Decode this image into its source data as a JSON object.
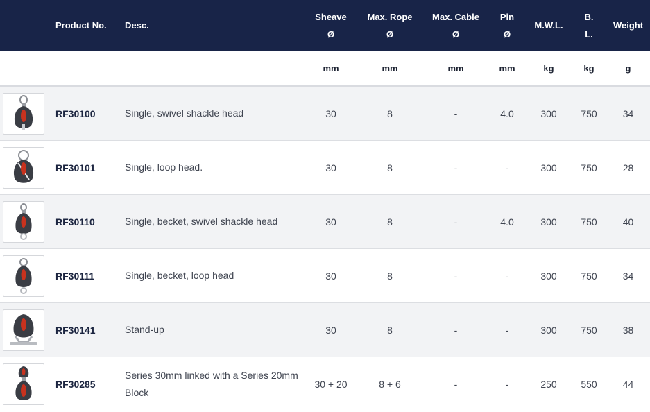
{
  "header": {
    "product_no": "Product No.",
    "desc": "Desc.",
    "sheave": [
      "Sheave",
      "Ø"
    ],
    "max_rope": [
      "Max. Rope",
      "Ø"
    ],
    "max_cable": [
      "Max. Cable",
      "Ø"
    ],
    "pin": [
      "Pin",
      "Ø"
    ],
    "mwl": "M.W.L.",
    "bl": [
      "B.",
      "L."
    ],
    "weight": "Weight"
  },
  "units": {
    "sheave": "mm",
    "max_rope": "mm",
    "max_cable": "mm",
    "pin": "mm",
    "mwl": "kg",
    "bl": "kg",
    "weight": "g"
  },
  "rows": [
    {
      "product": "RF30100",
      "desc": "Single, swivel shackle head",
      "sheave": "30",
      "rope": "8",
      "cable": "-",
      "pin": "4.0",
      "mwl": "300",
      "bl": "750",
      "weight": "34",
      "image_icon": "pulley-block-swivel-shackle-icon"
    },
    {
      "product": "RF30101",
      "desc": "Single, loop head.",
      "sheave": "30",
      "rope": "8",
      "cable": "-",
      "pin": "-",
      "mwl": "300",
      "bl": "750",
      "weight": "28",
      "image_icon": "pulley-block-loop-icon"
    },
    {
      "product": "RF30110",
      "desc": "Single, becket, swivel shackle head",
      "sheave": "30",
      "rope": "8",
      "cable": "-",
      "pin": "4.0",
      "mwl": "300",
      "bl": "750",
      "weight": "40",
      "image_icon": "pulley-block-becket-swivel-icon"
    },
    {
      "product": "RF30111",
      "desc": "Single, becket, loop head",
      "sheave": "30",
      "rope": "8",
      "cable": "-",
      "pin": "-",
      "mwl": "300",
      "bl": "750",
      "weight": "34",
      "image_icon": "pulley-block-becket-loop-icon"
    },
    {
      "product": "RF30141",
      "desc": "Stand-up",
      "sheave": "30",
      "rope": "8",
      "cable": "-",
      "pin": "-",
      "mwl": "300",
      "bl": "750",
      "weight": "38",
      "image_icon": "pulley-block-standup-icon"
    },
    {
      "product": "RF30285",
      "desc": "Series 30mm linked with a Series 20mm Block",
      "sheave": "30 + 20",
      "rope": "8 + 6",
      "cable": "-",
      "pin": "-",
      "mwl": "250",
      "bl": "550",
      "weight": "44",
      "image_icon": "pulley-block-linked-icon"
    }
  ],
  "colors": {
    "header_bg": "#182448",
    "row_alt_bg": "#f2f3f5",
    "block_body": "#3a3d44",
    "block_accent": "#c8321e"
  }
}
